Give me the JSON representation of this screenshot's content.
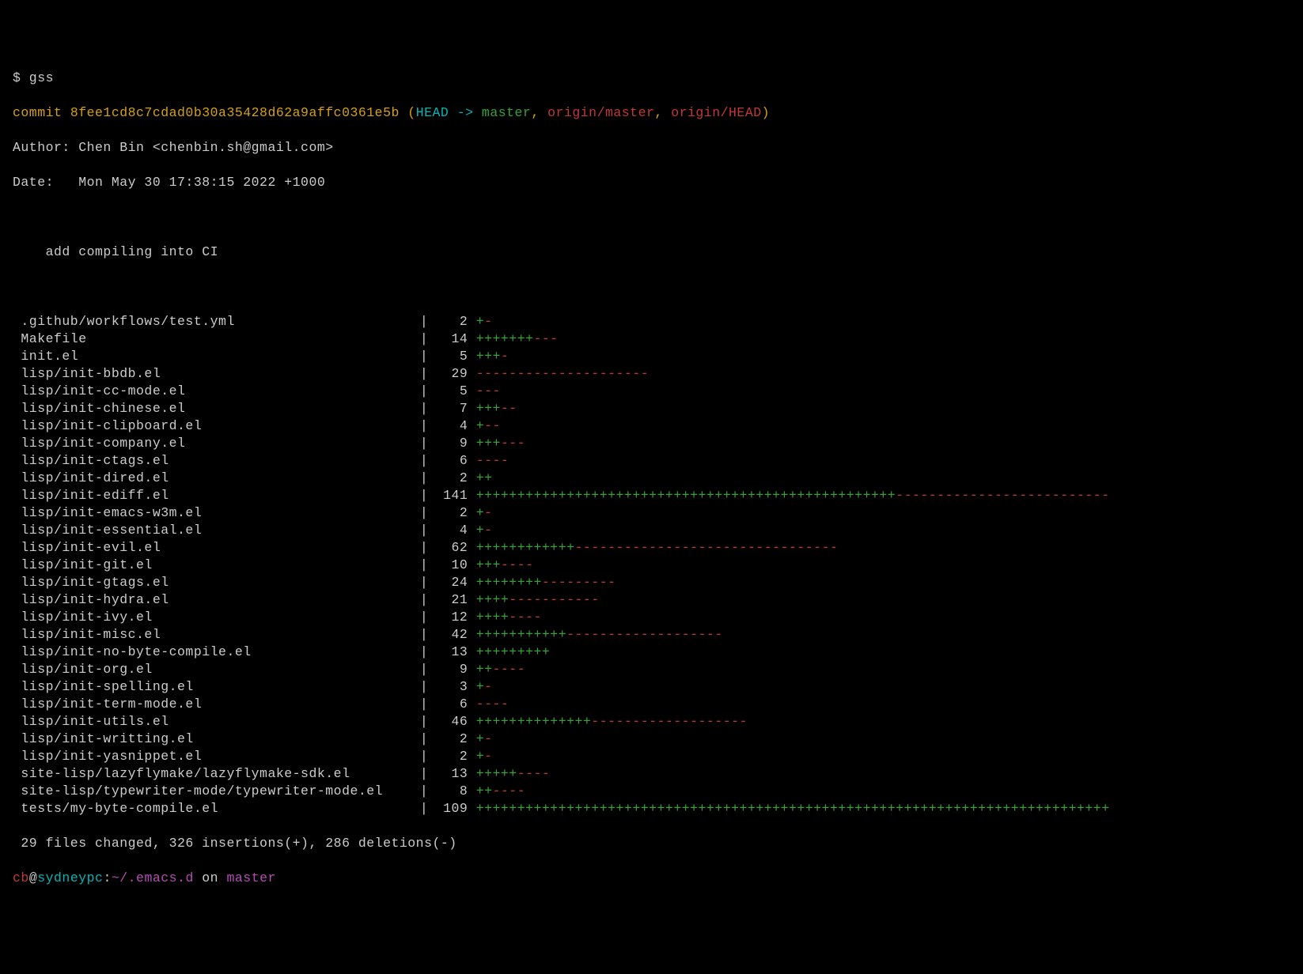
{
  "top_line": "$ gss",
  "commit_word": "commit ",
  "commit_hash": "8fee1cd8c7cdad0b30a35428d62a9affc0361e5b",
  "refs_open": " (",
  "refs_head": "HEAD -> ",
  "refs_master": "master",
  "refs_sep1": ", ",
  "refs_origin_master": "origin/master",
  "refs_sep2": ", ",
  "refs_origin_head": "origin/HEAD",
  "refs_close": ")",
  "author_line": "Author: Chen Bin <chenbin.sh@gmail.com>",
  "date_line": "Date:   Mon May 30 17:38:15 2022 +1000",
  "message": "    add compiling into CI",
  "files": [
    {
      "name": " .github/workflows/test.yml",
      "n": "2",
      "plus": 1,
      "minus": 1
    },
    {
      "name": " Makefile",
      "n": "14",
      "plus": 7,
      "minus": 3
    },
    {
      "name": " init.el",
      "n": "5",
      "plus": 3,
      "minus": 1
    },
    {
      "name": " lisp/init-bbdb.el",
      "n": "29",
      "plus": 0,
      "minus": 21
    },
    {
      "name": " lisp/init-cc-mode.el",
      "n": "5",
      "plus": 0,
      "minus": 3
    },
    {
      "name": " lisp/init-chinese.el",
      "n": "7",
      "plus": 3,
      "minus": 2
    },
    {
      "name": " lisp/init-clipboard.el",
      "n": "4",
      "plus": 1,
      "minus": 2
    },
    {
      "name": " lisp/init-company.el",
      "n": "9",
      "plus": 3,
      "minus": 3
    },
    {
      "name": " lisp/init-ctags.el",
      "n": "6",
      "plus": 0,
      "minus": 4
    },
    {
      "name": " lisp/init-dired.el",
      "n": "2",
      "plus": 2,
      "minus": 0
    },
    {
      "name": " lisp/init-ediff.el",
      "n": "141",
      "plus": 51,
      "minus": 26
    },
    {
      "name": " lisp/init-emacs-w3m.el",
      "n": "2",
      "plus": 1,
      "minus": 1
    },
    {
      "name": " lisp/init-essential.el",
      "n": "4",
      "plus": 1,
      "minus": 1
    },
    {
      "name": " lisp/init-evil.el",
      "n": "62",
      "plus": 12,
      "minus": 32
    },
    {
      "name": " lisp/init-git.el",
      "n": "10",
      "plus": 3,
      "minus": 4
    },
    {
      "name": " lisp/init-gtags.el",
      "n": "24",
      "plus": 8,
      "minus": 9
    },
    {
      "name": " lisp/init-hydra.el",
      "n": "21",
      "plus": 4,
      "minus": 11
    },
    {
      "name": " lisp/init-ivy.el",
      "n": "12",
      "plus": 4,
      "minus": 4
    },
    {
      "name": " lisp/init-misc.el",
      "n": "42",
      "plus": 11,
      "minus": 19
    },
    {
      "name": " lisp/init-no-byte-compile.el",
      "n": "13",
      "plus": 9,
      "minus": 0
    },
    {
      "name": " lisp/init-org.el",
      "n": "9",
      "plus": 2,
      "minus": 4
    },
    {
      "name": " lisp/init-spelling.el",
      "n": "3",
      "plus": 1,
      "minus": 1
    },
    {
      "name": " lisp/init-term-mode.el",
      "n": "6",
      "plus": 0,
      "minus": 4
    },
    {
      "name": " lisp/init-utils.el",
      "n": "46",
      "plus": 14,
      "minus": 19
    },
    {
      "name": " lisp/init-writting.el",
      "n": "2",
      "plus": 1,
      "minus": 1
    },
    {
      "name": " lisp/init-yasnippet.el",
      "n": "2",
      "plus": 1,
      "minus": 1
    },
    {
      "name": " site-lisp/lazyflymake/lazyflymake-sdk.el",
      "n": "13",
      "plus": 5,
      "minus": 4
    },
    {
      "name": " site-lisp/typewriter-mode/typewriter-mode.el",
      "n": "8",
      "plus": 2,
      "minus": 4
    },
    {
      "name": " tests/my-byte-compile.el",
      "n": "109",
      "plus": 77,
      "minus": 0
    }
  ],
  "summary": " 29 files changed, 326 insertions(+), 286 deletions(-)",
  "prompt": {
    "user": "cb",
    "at": "@",
    "host": "sydneypc",
    "colon": ":",
    "path": "~/.emacs.d",
    "on": " on ",
    "branch": "master"
  }
}
